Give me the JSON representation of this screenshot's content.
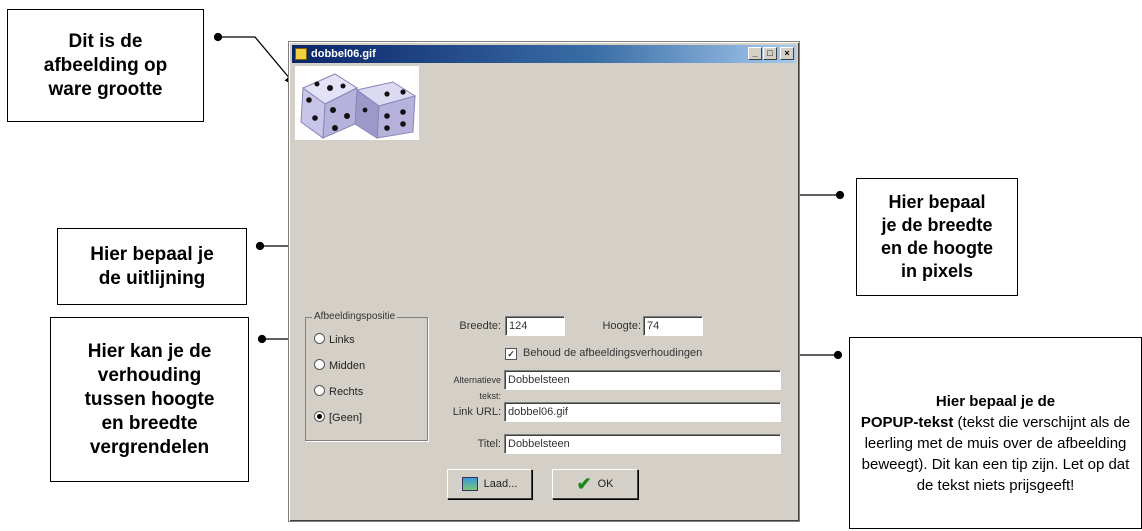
{
  "window": {
    "title": "dobbel06.gif",
    "controls": {
      "minimize": "_",
      "maximize": "□",
      "close": "×"
    }
  },
  "position_group": {
    "legend": "Afbeeldingspositie",
    "options": [
      {
        "label": "Links",
        "selected": false
      },
      {
        "label": "Midden",
        "selected": false
      },
      {
        "label": "Rechts",
        "selected": false
      },
      {
        "label": "[Geen]",
        "selected": true
      }
    ]
  },
  "size": {
    "width_label": "Breedte:",
    "width_value": "124",
    "height_label": "Hoogte:",
    "height_value": "74"
  },
  "keep_ratio": {
    "checked": true,
    "label": "Behoud de afbeeldingsverhoudingen"
  },
  "fields": {
    "alt_label": "Alternatieve tekst:",
    "alt_value": "Dobbelsteen",
    "link_label": "Link URL:",
    "link_value": "dobbel06.gif",
    "title_label": "Titel:",
    "title_value": "Dobbelsteen"
  },
  "buttons": {
    "load": "Laad...",
    "ok": "OK"
  },
  "callouts": {
    "real_size": "Dit is de\nafbeelding op\nware grootte",
    "alignment": "Hier bepaal je\nde uitlijning",
    "ratio": "Hier kan je de\nverhouding\ntussen hoogte\nen breedte\nvergrendelen",
    "size": "Hier bepaal\nje de breedte\nen de hoogte\nin pixels",
    "popup_bold": "Hier bepaal je de\nPOPUP-tekst",
    "popup_rest": " (tekst die verschijnt als de leerling met de muis over de afbeelding beweegt). Dit kan een tip zijn. Let op dat de tekst niets prijsgeeft!"
  },
  "colors": {
    "titlebar": "#0a246a",
    "dialog": "#d4d0c8",
    "die": "#b6b2dc"
  }
}
